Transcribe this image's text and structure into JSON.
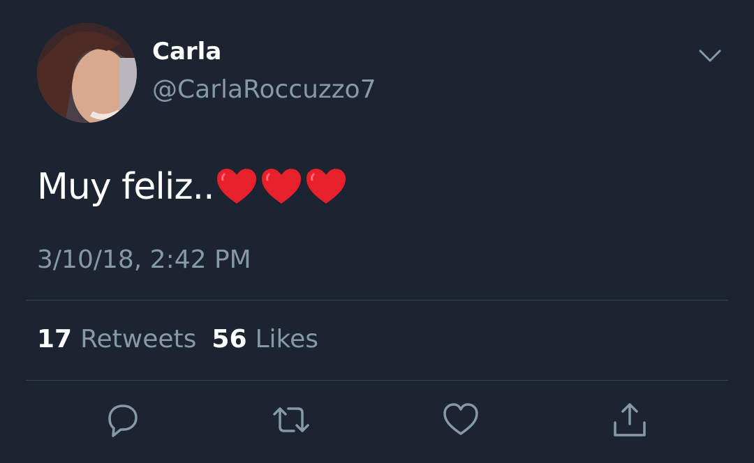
{
  "tweet": {
    "author_name": "Carla",
    "handle": "@CarlaRoccuzzo7",
    "text": "Muy feliz..",
    "emoji": [
      "red-heart",
      "red-heart",
      "red-heart"
    ],
    "timestamp": "3/10/18, 2:42 PM"
  },
  "stats": {
    "retweets_count": "17",
    "retweets_label": "Retweets",
    "likes_count": "56",
    "likes_label": "Likes"
  },
  "actions": [
    {
      "name": "reply",
      "icon": "reply-icon"
    },
    {
      "name": "retweet",
      "icon": "retweet-icon"
    },
    {
      "name": "like",
      "icon": "heart-icon"
    },
    {
      "name": "share",
      "icon": "share-icon"
    }
  ],
  "colors": {
    "background": "#1b2430",
    "primary_text": "#ffffff",
    "secondary_text": "#8899a6",
    "divider": "#38444d",
    "heart_emoji": "#e8202c"
  }
}
